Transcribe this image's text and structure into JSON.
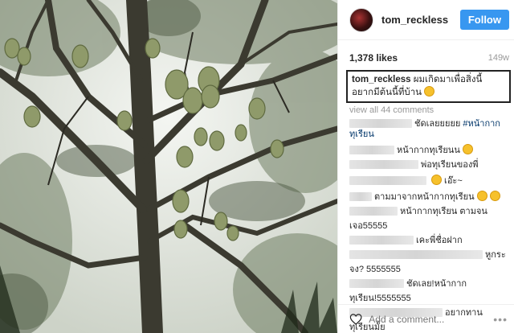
{
  "post": {
    "username": "tom_reckless",
    "follow_label": "Follow",
    "likes": "1,378 likes",
    "time": "149w",
    "caption_user": "tom_reckless",
    "caption_text": " ผมเกิดมาเพื่อสิ่งนี้ อยากมีต้นนี้ที่บ้าน",
    "view_all": "view all 44 comments",
    "add_comment_placeholder": "Add a comment...",
    "more_label": "•••"
  },
  "comments": [
    {
      "text": "ชัดเลยยยยย ",
      "tag": "#หน้ากากทุเรียน"
    },
    {
      "text": "หน้ากากทุเรียนน"
    },
    {
      "text": "พ่อทุเรียนของพี่"
    },
    {
      "text": " เอ๊ะ~"
    },
    {
      "text": "ตามมาจากหน้ากากทุเรียน"
    },
    {
      "text": "หน้ากากทุเรียน ตามจน"
    },
    {
      "text": "เจอ55555"
    },
    {
      "text": "เคะพี่ชื่อฝาก"
    },
    {
      "text": "หูกระ"
    },
    {
      "text": "จง? 5555555"
    },
    {
      "text": "ชัดเลย!หน้ากาก"
    },
    {
      "text": "ทุเรียน!5555555"
    },
    {
      "text": "อยากทาน"
    },
    {
      "text": "ทุเรียนมั้ย"
    }
  ]
}
